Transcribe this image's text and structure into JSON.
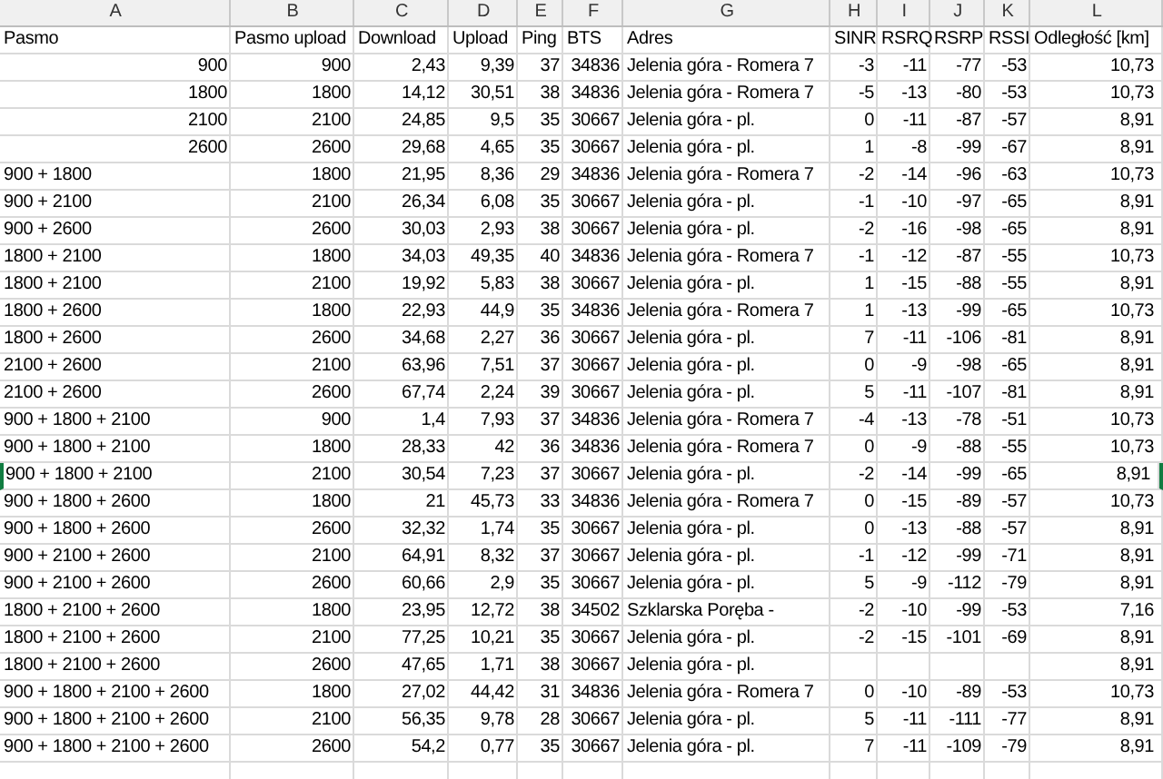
{
  "columns": [
    {
      "letter": "A",
      "header": "Pasmo"
    },
    {
      "letter": "B",
      "header": "Pasmo upload"
    },
    {
      "letter": "C",
      "header": "Download"
    },
    {
      "letter": "D",
      "header": "Upload"
    },
    {
      "letter": "E",
      "header": "Ping"
    },
    {
      "letter": "F",
      "header": "BTS"
    },
    {
      "letter": "G",
      "header": "Adres"
    },
    {
      "letter": "H",
      "header": "SINR"
    },
    {
      "letter": "I",
      "header": "RSRQ"
    },
    {
      "letter": "J",
      "header": "RSRP"
    },
    {
      "letter": "K",
      "header": "RSSI"
    },
    {
      "letter": "L",
      "header": "Odległość [km]"
    }
  ],
  "rows": [
    {
      "kind": "number",
      "selected": false,
      "cells": [
        "900",
        "900",
        "2,43",
        "9,39",
        "37",
        "34836",
        "Jelenia góra - Romera 7",
        "-3",
        "-11",
        "-77",
        "-53",
        "10,73"
      ]
    },
    {
      "kind": "number",
      "selected": false,
      "cells": [
        "1800",
        "1800",
        "14,12",
        "30,51",
        "38",
        "34836",
        "Jelenia góra - Romera 7",
        "-5",
        "-13",
        "-80",
        "-53",
        "10,73"
      ]
    },
    {
      "kind": "number",
      "selected": false,
      "cells": [
        "2100",
        "2100",
        "24,85",
        "9,5",
        "35",
        "30667",
        "Jelenia góra - pl.",
        "0",
        "-11",
        "-87",
        "-57",
        "8,91"
      ]
    },
    {
      "kind": "number",
      "selected": false,
      "cells": [
        "2600",
        "2600",
        "29,68",
        "4,65",
        "35",
        "30667",
        "Jelenia góra - pl.",
        "1",
        "-8",
        "-99",
        "-67",
        "8,91"
      ]
    },
    {
      "kind": "text",
      "selected": false,
      "cells": [
        "900 + 1800",
        "1800",
        "21,95",
        "8,36",
        "29",
        "34836",
        "Jelenia góra - Romera 7",
        "-2",
        "-14",
        "-96",
        "-63",
        "10,73"
      ]
    },
    {
      "kind": "text",
      "selected": false,
      "cells": [
        "900 + 2100",
        "2100",
        "26,34",
        "6,08",
        "35",
        "30667",
        "Jelenia góra - pl.",
        "-1",
        "-10",
        "-97",
        "-65",
        "8,91"
      ]
    },
    {
      "kind": "text",
      "selected": false,
      "cells": [
        "900 + 2600",
        "2600",
        "30,03",
        "2,93",
        "38",
        "30667",
        "Jelenia góra - pl.",
        "-2",
        "-16",
        "-98",
        "-65",
        "8,91"
      ]
    },
    {
      "kind": "text",
      "selected": false,
      "cells": [
        "1800 + 2100",
        "1800",
        "34,03",
        "49,35",
        "40",
        "34836",
        "Jelenia góra - Romera 7",
        "-1",
        "-12",
        "-87",
        "-55",
        "10,73"
      ]
    },
    {
      "kind": "text",
      "selected": false,
      "cells": [
        "1800 + 2100",
        "2100",
        "19,92",
        "5,83",
        "38",
        "30667",
        "Jelenia góra - pl.",
        "1",
        "-15",
        "-88",
        "-55",
        "8,91"
      ]
    },
    {
      "kind": "text",
      "selected": false,
      "cells": [
        "1800 + 2600",
        "1800",
        "22,93",
        "44,9",
        "35",
        "34836",
        "Jelenia góra - Romera 7",
        "1",
        "-13",
        "-99",
        "-65",
        "10,73"
      ]
    },
    {
      "kind": "text",
      "selected": false,
      "cells": [
        "1800 + 2600",
        "2600",
        "34,68",
        "2,27",
        "36",
        "30667",
        "Jelenia góra - pl.",
        "7",
        "-11",
        "-106",
        "-81",
        "8,91"
      ]
    },
    {
      "kind": "text",
      "selected": false,
      "cells": [
        "2100 + 2600",
        "2100",
        "63,96",
        "7,51",
        "37",
        "30667",
        "Jelenia góra - pl.",
        "0",
        "-9",
        "-98",
        "-65",
        "8,91"
      ]
    },
    {
      "kind": "text",
      "selected": false,
      "cells": [
        "2100 + 2600",
        "2600",
        "67,74",
        "2,24",
        "39",
        "30667",
        "Jelenia góra - pl.",
        "5",
        "-11",
        "-107",
        "-81",
        "8,91"
      ]
    },
    {
      "kind": "text",
      "selected": false,
      "cells": [
        "900 + 1800 + 2100",
        "900",
        "1,4",
        "7,93",
        "37",
        "34836",
        "Jelenia góra - Romera 7",
        "-4",
        "-13",
        "-78",
        "-51",
        "10,73"
      ]
    },
    {
      "kind": "text",
      "selected": false,
      "cells": [
        "900 + 1800 + 2100",
        "1800",
        "28,33",
        "42",
        "36",
        "34836",
        "Jelenia góra - Romera 7",
        "0",
        "-9",
        "-88",
        "-55",
        "10,73"
      ]
    },
    {
      "kind": "text",
      "selected": true,
      "cells": [
        "900 + 1800 + 2100",
        "2100",
        "30,54",
        "7,23",
        "37",
        "30667",
        "Jelenia góra - pl.",
        "-2",
        "-14",
        "-99",
        "-65",
        "8,91"
      ]
    },
    {
      "kind": "text",
      "selected": false,
      "cells": [
        "900 + 1800 + 2600",
        "1800",
        "21",
        "45,73",
        "33",
        "34836",
        "Jelenia góra - Romera 7",
        "0",
        "-15",
        "-89",
        "-57",
        "10,73"
      ]
    },
    {
      "kind": "text",
      "selected": false,
      "cells": [
        "900 + 1800 + 2600",
        "2600",
        "32,32",
        "1,74",
        "35",
        "30667",
        "Jelenia góra - pl.",
        "0",
        "-13",
        "-88",
        "-57",
        "8,91"
      ]
    },
    {
      "kind": "text",
      "selected": false,
      "cells": [
        "900 + 2100 + 2600",
        "2100",
        "64,91",
        "8,32",
        "37",
        "30667",
        "Jelenia góra - pl.",
        "-1",
        "-12",
        "-99",
        "-71",
        "8,91"
      ]
    },
    {
      "kind": "text",
      "selected": false,
      "cells": [
        "900 + 2100 + 2600",
        "2600",
        "60,66",
        "2,9",
        "35",
        "30667",
        "Jelenia góra - pl.",
        "5",
        "-9",
        "-112",
        "-79",
        "8,91"
      ]
    },
    {
      "kind": "text",
      "selected": false,
      "cells": [
        "1800 + 2100 + 2600",
        "1800",
        "23,95",
        "12,72",
        "38",
        "34502",
        "Szklarska Poręba -",
        "-2",
        "-10",
        "-99",
        "-53",
        "7,16"
      ]
    },
    {
      "kind": "text",
      "selected": false,
      "cells": [
        "1800 + 2100 + 2600",
        "2100",
        "77,25",
        "10,21",
        "35",
        "30667",
        "Jelenia góra - pl.",
        "-2",
        "-15",
        "-101",
        "-69",
        "8,91"
      ]
    },
    {
      "kind": "text",
      "selected": false,
      "cells": [
        "1800 + 2100 + 2600",
        "2600",
        "47,65",
        "1,71",
        "38",
        "30667",
        "Jelenia góra - pl.",
        null,
        null,
        null,
        null,
        "8,91"
      ]
    },
    {
      "kind": "text",
      "selected": false,
      "cells": [
        "900 + 1800 + 2100 + 2600",
        "1800",
        "27,02",
        "44,42",
        "31",
        "34836",
        "Jelenia góra - Romera 7",
        "0",
        "-10",
        "-89",
        "-53",
        "10,73"
      ]
    },
    {
      "kind": "text",
      "selected": false,
      "cells": [
        "900 + 1800 + 2100 + 2600",
        "2100",
        "56,35",
        "9,78",
        "28",
        "30667",
        "Jelenia góra - pl.",
        "5",
        "-11",
        "-111",
        "-77",
        "8,91"
      ]
    },
    {
      "kind": "text",
      "selected": false,
      "cells": [
        "900 + 1800 + 2100 + 2600",
        "2600",
        "54,2",
        "0,77",
        "35",
        "30667",
        "Jelenia góra - pl.",
        "7",
        "-11",
        "-109",
        "-79",
        "8,91"
      ]
    }
  ]
}
